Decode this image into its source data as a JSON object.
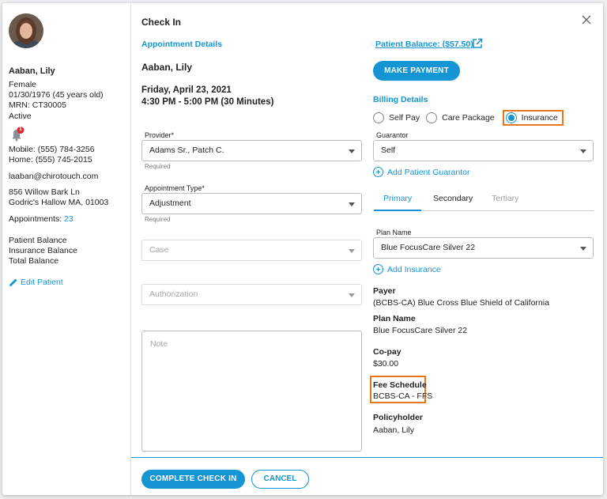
{
  "patient": {
    "name": "Aaban, Lily",
    "gender": "Female",
    "dob": "01/30/1976 (45 years old)",
    "mrn": "MRN: CT30005",
    "status": "Active",
    "notification_count": "1",
    "mobile": "Mobile: (555) 784-3256",
    "home": "Home: (555) 745-2015",
    "email": "laaban@chirotouch.com",
    "address1": "856 Willow Bark Ln",
    "address2": "Godric's Hallow MA, 01003",
    "appointments_label": "Appointments:",
    "appointments_count": "23",
    "patient_balance": "Patient Balance",
    "insurance_balance": "Insurance Balance",
    "total_balance": "Total Balance",
    "edit_label": "Edit Patient"
  },
  "dialog": {
    "title": "Check In",
    "close_icon": "close-icon"
  },
  "appointment": {
    "section_label": "Appointment Details",
    "patient_name": "Aaban, Lily",
    "date": "Friday, April 23, 2021",
    "time": "4:30 PM - 5:00 PM (30 Minutes)",
    "provider_label": "Provider*",
    "provider_value": "Adams Sr., Patch C.",
    "provider_hint": "Required",
    "type_label": "Appointment Type*",
    "type_value": "Adjustment",
    "type_hint": "Required",
    "case_placeholder": "Case",
    "authorization_placeholder": "Authorization",
    "note_placeholder": "Note"
  },
  "billing": {
    "patient_balance_link": "Patient Balance: ($57.50)",
    "make_payment": "MAKE PAYMENT",
    "section_label": "Billing Details",
    "options": [
      "Self Pay",
      "Care Package",
      "Insurance"
    ],
    "selected_option": "Insurance",
    "guarantor_label": "Guarantor",
    "guarantor_value": "Self",
    "add_guarantor": "Add Patient Guarantor",
    "tabs": [
      "Primary",
      "Secondary",
      "Tertiary"
    ],
    "active_tab": "Primary",
    "plan_name_label": "Plan Name",
    "plan_name_value": "Blue FocusCare Silver 22",
    "add_insurance": "Add Insurance",
    "payer_label": "Payer",
    "payer_value": "(BCBS-CA) Blue Cross Blue Shield of California",
    "plan_label": "Plan Name",
    "plan_value": "Blue FocusCare Silver 22",
    "copay_label": "Co-pay",
    "copay_value": "$30.00",
    "fee_schedule_label": "Fee Schedule",
    "fee_schedule_value": "BCBS-CA - FFS",
    "policyholder_label": "Policyholder",
    "policyholder_value": "Aaban, Lily"
  },
  "footer": {
    "complete_label": "COMPLETE CHECK IN",
    "cancel_label": "CANCEL"
  },
  "colors": {
    "accent": "#1595d3",
    "highlight": "#e87722",
    "notification": "#d9262c"
  }
}
